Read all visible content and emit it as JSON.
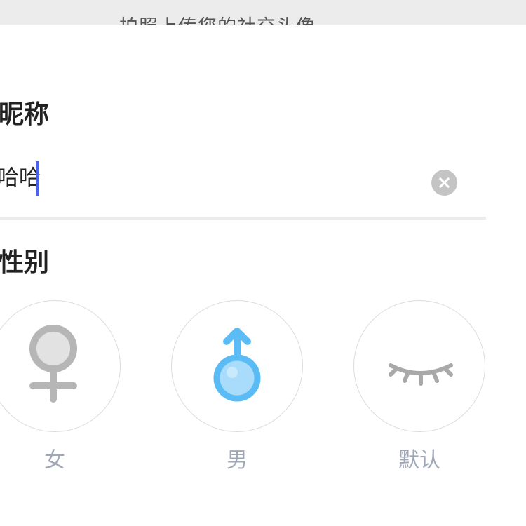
{
  "header": {
    "hint": "拍照上传您的社交头像"
  },
  "nickname": {
    "label": "昵称",
    "value": "哈哈"
  },
  "gender": {
    "label": "性别",
    "options": [
      {
        "label": "女",
        "icon": "female-symbol-icon"
      },
      {
        "label": "男",
        "icon": "male-symbol-icon"
      },
      {
        "label": "默认",
        "icon": "closed-eye-icon"
      }
    ],
    "selected": "男"
  },
  "colors": {
    "selected_icon": "#5bbcf5",
    "unselected_icon": "#b6b6b6",
    "caret": "#4a63e8",
    "option_label": "#a0a8b8"
  }
}
